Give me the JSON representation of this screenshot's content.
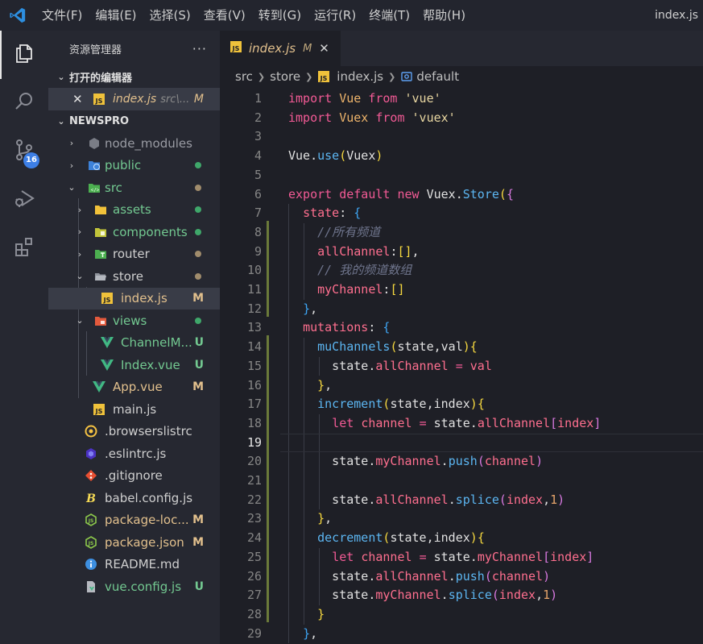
{
  "window": {
    "title": "index.js"
  },
  "menu": [
    "文件(F)",
    "编辑(E)",
    "选择(S)",
    "查看(V)",
    "转到(G)",
    "运行(R)",
    "终端(T)",
    "帮助(H)"
  ],
  "activity": {
    "items": [
      "explorer",
      "search",
      "source-control",
      "run-debug",
      "extensions"
    ],
    "scm_badge": "16"
  },
  "sidebar": {
    "title": "资源管理器",
    "more": "···",
    "open_editors_title": "打开的编辑器",
    "open_editor": {
      "name": "index.js",
      "path": "src\\...",
      "status": "M"
    },
    "project_title": "NEWSPRO",
    "tree": [
      {
        "label": "node_modules",
        "status": ""
      },
      {
        "label": "public",
        "status": "dot"
      },
      {
        "label": "src",
        "status": "dot"
      },
      {
        "label": "assets",
        "status": "dot"
      },
      {
        "label": "components",
        "status": "dot"
      },
      {
        "label": "router",
        "status": "dot"
      },
      {
        "label": "store",
        "status": "dot"
      },
      {
        "label": "index.js",
        "status": "M"
      },
      {
        "label": "views",
        "status": "dot"
      },
      {
        "label": "ChannelM...",
        "status": "U"
      },
      {
        "label": "Index.vue",
        "status": "U"
      },
      {
        "label": "App.vue",
        "status": "M"
      },
      {
        "label": "main.js",
        "status": ""
      },
      {
        "label": ".browserslistrc",
        "status": ""
      },
      {
        "label": ".eslintrc.js",
        "status": ""
      },
      {
        "label": ".gitignore",
        "status": ""
      },
      {
        "label": "babel.config.js",
        "status": ""
      },
      {
        "label": "package-loc...",
        "status": "M"
      },
      {
        "label": "package.json",
        "status": "M"
      },
      {
        "label": "README.md",
        "status": ""
      },
      {
        "label": "vue.config.js",
        "status": "U"
      }
    ]
  },
  "editor": {
    "tab": {
      "name": "index.js",
      "status": "M",
      "close": "✕"
    },
    "breadcrumb": [
      "src",
      "store",
      "index.js",
      "default"
    ],
    "line_numbers": [
      "1",
      "2",
      "3",
      "4",
      "5",
      "6",
      "7",
      "8",
      "9",
      "10",
      "11",
      "12",
      "13",
      "14",
      "15",
      "16",
      "17",
      "18",
      "19",
      "20",
      "21",
      "22",
      "23",
      "24",
      "25",
      "26",
      "27",
      "28",
      "29"
    ],
    "code": [
      [
        [
          "kw",
          "import "
        ],
        [
          "id",
          "Vue "
        ],
        [
          "kw",
          "from "
        ],
        [
          "str",
          "'vue'"
        ]
      ],
      [
        [
          "kw",
          "import "
        ],
        [
          "id",
          "Vuex "
        ],
        [
          "kw",
          "from "
        ],
        [
          "str",
          "'vuex'"
        ]
      ],
      [],
      [
        [
          "plain",
          "Vue."
        ],
        [
          "fn",
          "use"
        ],
        [
          "br1",
          "("
        ],
        [
          "plain",
          "Vuex"
        ],
        [
          "br1",
          ")"
        ]
      ],
      [],
      [
        [
          "kw",
          "export default new "
        ],
        [
          "plain",
          "Vuex."
        ],
        [
          "fn",
          "Store"
        ],
        [
          "br1",
          "("
        ],
        [
          "br2",
          "{"
        ]
      ],
      [
        [
          "plain",
          "  "
        ],
        [
          "prop",
          "state"
        ],
        [
          "plain",
          ": "
        ],
        [
          "br3",
          "{"
        ]
      ],
      [
        [
          "plain",
          "    "
        ],
        [
          "cmt",
          "//所有频道"
        ]
      ],
      [
        [
          "plain",
          "    "
        ],
        [
          "prop",
          "allChannel"
        ],
        [
          "plain",
          ":"
        ],
        [
          "br1",
          "[]"
        ],
        [
          "plain",
          ","
        ]
      ],
      [
        [
          "plain",
          "    "
        ],
        [
          "cmt",
          "// 我的频道数组"
        ]
      ],
      [
        [
          "plain",
          "    "
        ],
        [
          "prop",
          "myChannel"
        ],
        [
          "plain",
          ":"
        ],
        [
          "br1",
          "[]"
        ]
      ],
      [
        [
          "plain",
          "  "
        ],
        [
          "br3",
          "}"
        ],
        [
          "plain",
          ","
        ]
      ],
      [
        [
          "plain",
          "  "
        ],
        [
          "prop",
          "mutations"
        ],
        [
          "plain",
          ": "
        ],
        [
          "br3",
          "{"
        ]
      ],
      [
        [
          "plain",
          "    "
        ],
        [
          "fn",
          "muChannels"
        ],
        [
          "br1",
          "("
        ],
        [
          "plain",
          "state,val"
        ],
        [
          "br1",
          ")"
        ],
        [
          "br1",
          "{"
        ]
      ],
      [
        [
          "plain",
          "      state."
        ],
        [
          "prop",
          "allChannel"
        ],
        [
          "plain",
          " "
        ],
        [
          "kw",
          "="
        ],
        [
          "plain",
          " "
        ],
        [
          "prop",
          "val"
        ]
      ],
      [
        [
          "plain",
          "    "
        ],
        [
          "br1",
          "}"
        ],
        [
          "plain",
          ","
        ]
      ],
      [
        [
          "plain",
          "    "
        ],
        [
          "fn",
          "increment"
        ],
        [
          "br1",
          "("
        ],
        [
          "plain",
          "state,index"
        ],
        [
          "br1",
          ")"
        ],
        [
          "br1",
          "{"
        ]
      ],
      [
        [
          "plain",
          "      "
        ],
        [
          "kw",
          "let "
        ],
        [
          "prop",
          "channel "
        ],
        [
          "kw",
          "= "
        ],
        [
          "plain",
          "state."
        ],
        [
          "prop",
          "allChannel"
        ],
        [
          "br2",
          "["
        ],
        [
          "prop",
          "index"
        ],
        [
          "br2",
          "]"
        ]
      ],
      [],
      [
        [
          "plain",
          "      state."
        ],
        [
          "prop",
          "myChannel"
        ],
        [
          "plain",
          "."
        ],
        [
          "fn",
          "push"
        ],
        [
          "br2",
          "("
        ],
        [
          "prop",
          "channel"
        ],
        [
          "br2",
          ")"
        ]
      ],
      [],
      [
        [
          "plain",
          "      state."
        ],
        [
          "prop",
          "allChannel"
        ],
        [
          "plain",
          "."
        ],
        [
          "fn",
          "splice"
        ],
        [
          "br2",
          "("
        ],
        [
          "prop",
          "index"
        ],
        [
          "plain",
          ","
        ],
        [
          "num-l",
          "1"
        ],
        [
          "br2",
          ")"
        ]
      ],
      [
        [
          "plain",
          "    "
        ],
        [
          "br1",
          "}"
        ],
        [
          "plain",
          ","
        ]
      ],
      [
        [
          "plain",
          "    "
        ],
        [
          "fn",
          "decrement"
        ],
        [
          "br1",
          "("
        ],
        [
          "plain",
          "state,index"
        ],
        [
          "br1",
          ")"
        ],
        [
          "br1",
          "{"
        ]
      ],
      [
        [
          "plain",
          "      "
        ],
        [
          "kw",
          "let "
        ],
        [
          "prop",
          "channel "
        ],
        [
          "kw",
          "= "
        ],
        [
          "plain",
          "state."
        ],
        [
          "prop",
          "myChannel"
        ],
        [
          "br2",
          "["
        ],
        [
          "prop",
          "index"
        ],
        [
          "br2",
          "]"
        ]
      ],
      [
        [
          "plain",
          "      state."
        ],
        [
          "prop",
          "allChannel"
        ],
        [
          "plain",
          "."
        ],
        [
          "fn",
          "push"
        ],
        [
          "br2",
          "("
        ],
        [
          "prop",
          "channel"
        ],
        [
          "br2",
          ")"
        ]
      ],
      [
        [
          "plain",
          "      state."
        ],
        [
          "prop",
          "myChannel"
        ],
        [
          "plain",
          "."
        ],
        [
          "fn",
          "splice"
        ],
        [
          "br2",
          "("
        ],
        [
          "prop",
          "index"
        ],
        [
          "plain",
          ","
        ],
        [
          "num-l",
          "1"
        ],
        [
          "br2",
          ")"
        ]
      ],
      [
        [
          "plain",
          "    "
        ],
        [
          "br1",
          "}"
        ]
      ],
      [
        [
          "plain",
          "  "
        ],
        [
          "br3",
          "}"
        ],
        [
          "plain",
          ","
        ]
      ]
    ],
    "current_line": "19"
  },
  "colors": {
    "folder_green": "#69c27e",
    "modified": "#e2c08d",
    "untracked": "#73c991",
    "dot_green": "#3fa76a",
    "dot_brown": "#a08c6c"
  }
}
